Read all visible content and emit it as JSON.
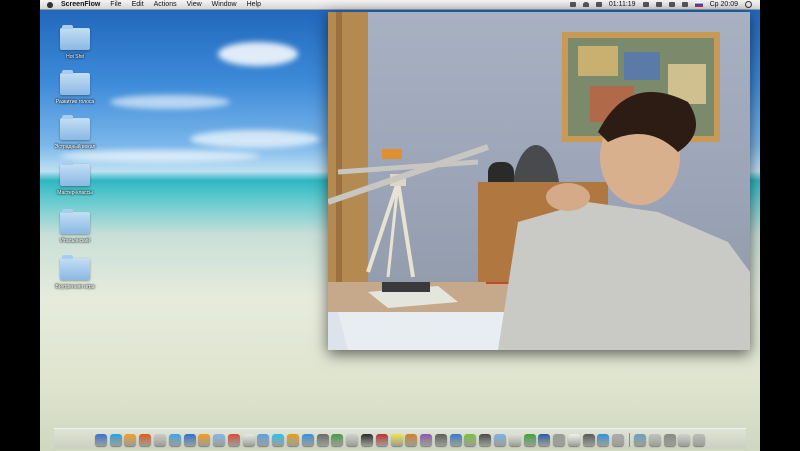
{
  "menubar": {
    "app_name": "ScreenFlow",
    "items": [
      "File",
      "Edit",
      "Actions",
      "View",
      "Window",
      "Help"
    ],
    "recording_time": "01:11:19",
    "clock": "Ср 20:09"
  },
  "desktop": {
    "icons": [
      {
        "label": "Hot Shit"
      },
      {
        "label": "Развитие голоса"
      },
      {
        "label": "Эстрадный вокал"
      },
      {
        "label": "Мастер-классы"
      },
      {
        "label": "Итальянский"
      },
      {
        "label": "Внутренняя игра"
      }
    ]
  },
  "video": {
    "description_icon": "webcam-video-icon"
  },
  "dock": {
    "colors": [
      "#3b6fd4",
      "#2aa0e0",
      "#f29a2e",
      "#e05a1c",
      "#c9c9c9",
      "#3da5e8",
      "#2f6fd8",
      "#f09a20",
      "#8ab4e6",
      "#d94a3a",
      "#e8e8e8",
      "#5aa0e6",
      "#2ec0f0",
      "#e0a020",
      "#3a8fe0",
      "#6a6a6a",
      "#4a9a4a",
      "#cfcfcf",
      "#2b2b2b",
      "#c03030",
      "#f0e04a",
      "#d08030",
      "#8a5ab0",
      "#5c5c5c",
      "#3a7ad0",
      "#7ac040",
      "#4a4a4a",
      "#7ab0e8",
      "#e0e0e0",
      "#3fa03f",
      "#2a5ca8",
      "#9a9a9a",
      "#f0f0f0",
      "#5a5a5a",
      "#3090e0",
      "#aaaaaa",
      "#6aa0c0",
      "#c0c0c0",
      "#888888",
      "#d0d0d0",
      "#bbbbbb"
    ]
  }
}
